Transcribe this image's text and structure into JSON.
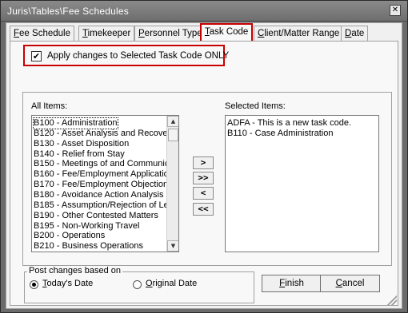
{
  "window": {
    "title": "Juris\\Tables\\Fee Schedules",
    "close_glyph": "✕"
  },
  "tabs": [
    {
      "acc": "F",
      "rest": "ee Schedule"
    },
    {
      "acc": "T",
      "rest": "imekeeper"
    },
    {
      "acc": "P",
      "rest": "ersonnel Type"
    },
    {
      "acc": "T",
      "rest": "ask Code"
    },
    {
      "acc": "C",
      "rest": "lient/Matter Range"
    },
    {
      "acc": "D",
      "rest": "ate"
    }
  ],
  "apply": {
    "checked": true,
    "check_glyph": "✔",
    "label": "Apply changes to Selected Task Code ONLY"
  },
  "all_items": {
    "label": "All Items:",
    "items": [
      "B100 - Administration",
      "B120 - Asset Analysis and Recove",
      "B130 - Asset Disposition",
      "B140 - Relief from Stay",
      "B150 - Meetings of and Communic",
      "B160 - Fee/Employment Applicatio",
      "B170 - Fee/Employment Objection",
      "B180 - Avoidance Action Analysis",
      "B185 - Assumption/Rejection of Le",
      "B190 - Other Contested Matters",
      "B195 - Non-Working Travel",
      "B200 - Operations",
      "B210 - Business Operations"
    ]
  },
  "selected_items": {
    "label": "Selected Items:",
    "items": [
      "ADFA - This is a new task code.",
      "B110 - Case Administration"
    ]
  },
  "move_buttons": {
    "add": ">",
    "add_all": ">>",
    "remove": "<",
    "remove_all": "<<"
  },
  "scroll_glyphs": {
    "up": "▲",
    "down": "▼"
  },
  "post_changes": {
    "legend": "Post changes based on",
    "options": [
      {
        "acc": "T",
        "rest": "oday's Date",
        "selected": true
      },
      {
        "acc": "O",
        "rest": "riginal Date",
        "selected": false
      }
    ]
  },
  "buttons": {
    "finish": {
      "acc": "F",
      "rest": "inish"
    },
    "cancel": {
      "acc": "C",
      "rest": "ancel"
    }
  },
  "colors": {
    "highlight_red": "#c80000",
    "title_bar": "#787878"
  }
}
